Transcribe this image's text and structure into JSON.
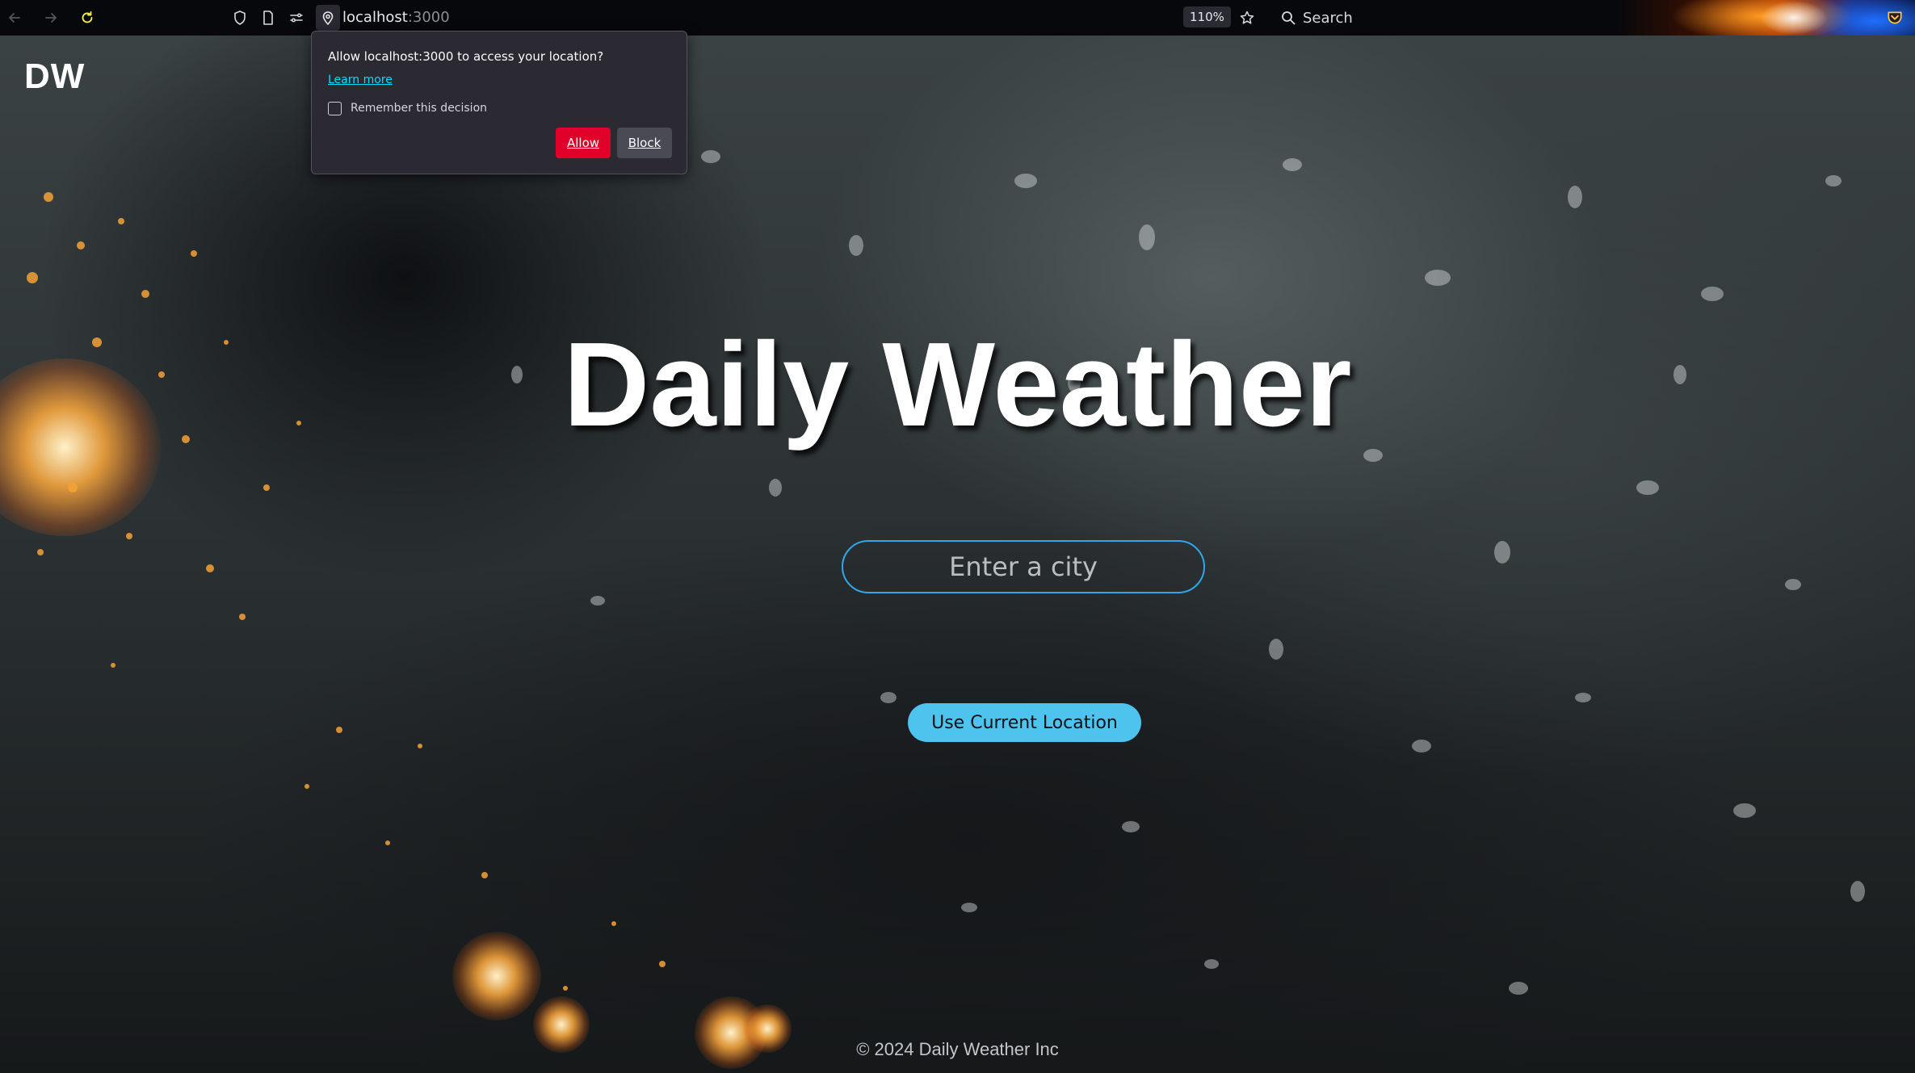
{
  "browser": {
    "url_host": "localhost",
    "url_port": ":3000",
    "zoom": "110%",
    "search_label": "Search",
    "icons": [
      "back-arrow-icon",
      "forward-arrow-icon",
      "reload-icon",
      "shield-icon",
      "page-icon",
      "permissions-icon",
      "location-pin-icon",
      "star-icon",
      "search-icon",
      "pocket-icon"
    ]
  },
  "permission_popup": {
    "question": "Allow localhost:3000 to access your location?",
    "learn_more": "Learn more",
    "remember_label": "Remember this decision",
    "remember_checked": false,
    "allow_label": "Allow",
    "block_label": "Block",
    "allow_color": "#e0002a"
  },
  "page": {
    "logo": "DW",
    "title": "Daily Weather",
    "search_placeholder": "Enter a city",
    "location_button": "Use Current Location",
    "footer": "© 2024 Daily Weather Inc",
    "accent_color": "#4ec3ee",
    "input_border_color": "#2fa7e8"
  }
}
